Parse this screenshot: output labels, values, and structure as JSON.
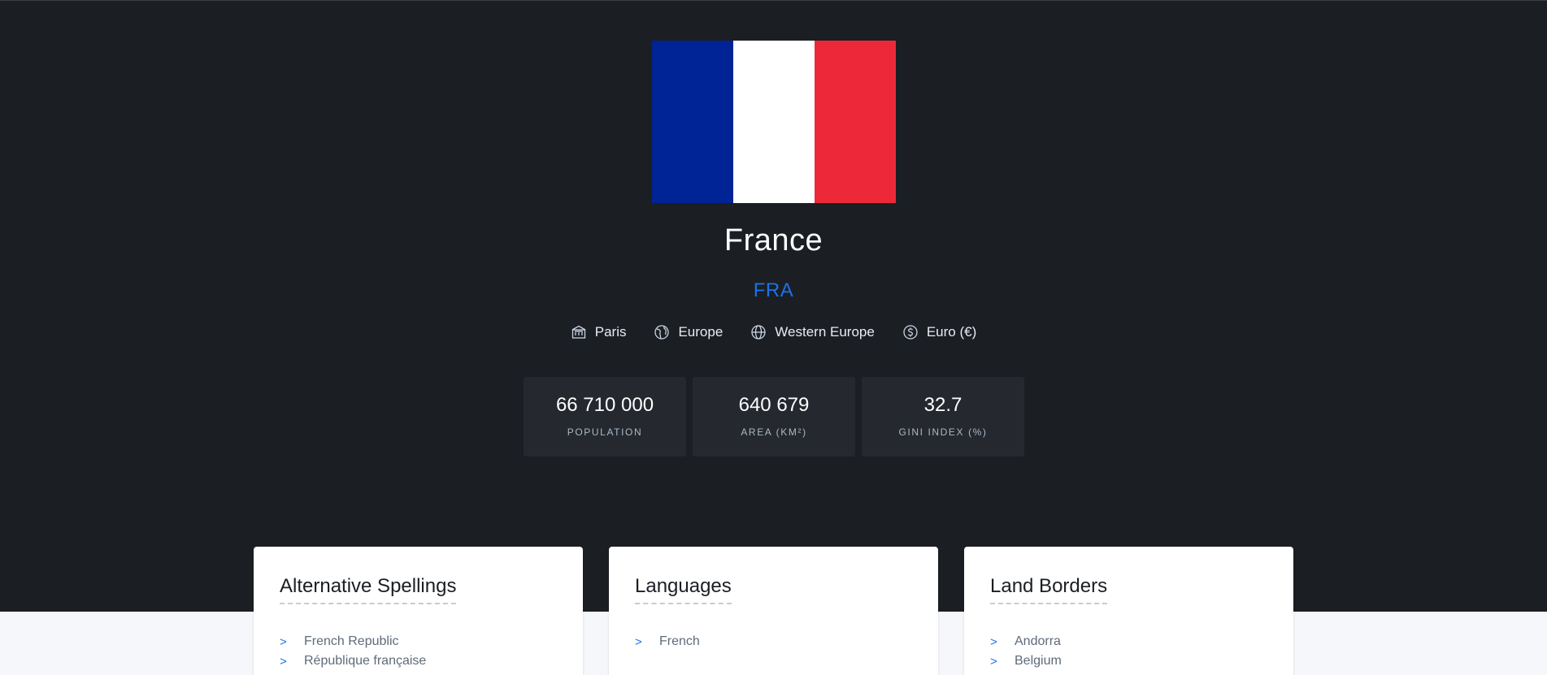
{
  "country": {
    "name": "France",
    "code": "FRA",
    "flag_colors": [
      "#002395",
      "#ffffff",
      "#ed2939"
    ]
  },
  "meta": {
    "capital": "Paris",
    "region": "Europe",
    "subregion": "Western Europe",
    "currency": "Euro (€)"
  },
  "stats": [
    {
      "value": "66 710 000",
      "label": "POPULATION"
    },
    {
      "value": "640 679",
      "label": "AREA (KM²)"
    },
    {
      "value": "32.7",
      "label": "GINI INDEX (%)"
    }
  ],
  "cards": {
    "spellings": {
      "title": "Alternative Spellings",
      "items": [
        "French Republic",
        "République française"
      ]
    },
    "languages": {
      "title": "Languages",
      "items": [
        "French"
      ]
    },
    "borders": {
      "title": "Land Borders",
      "items": [
        "Andorra",
        "Belgium"
      ]
    }
  },
  "list_marker": ">",
  "colors": {
    "accent": "#1a73e8",
    "hero_bg": "#1b1e23",
    "stat_bg": "#25282e"
  }
}
